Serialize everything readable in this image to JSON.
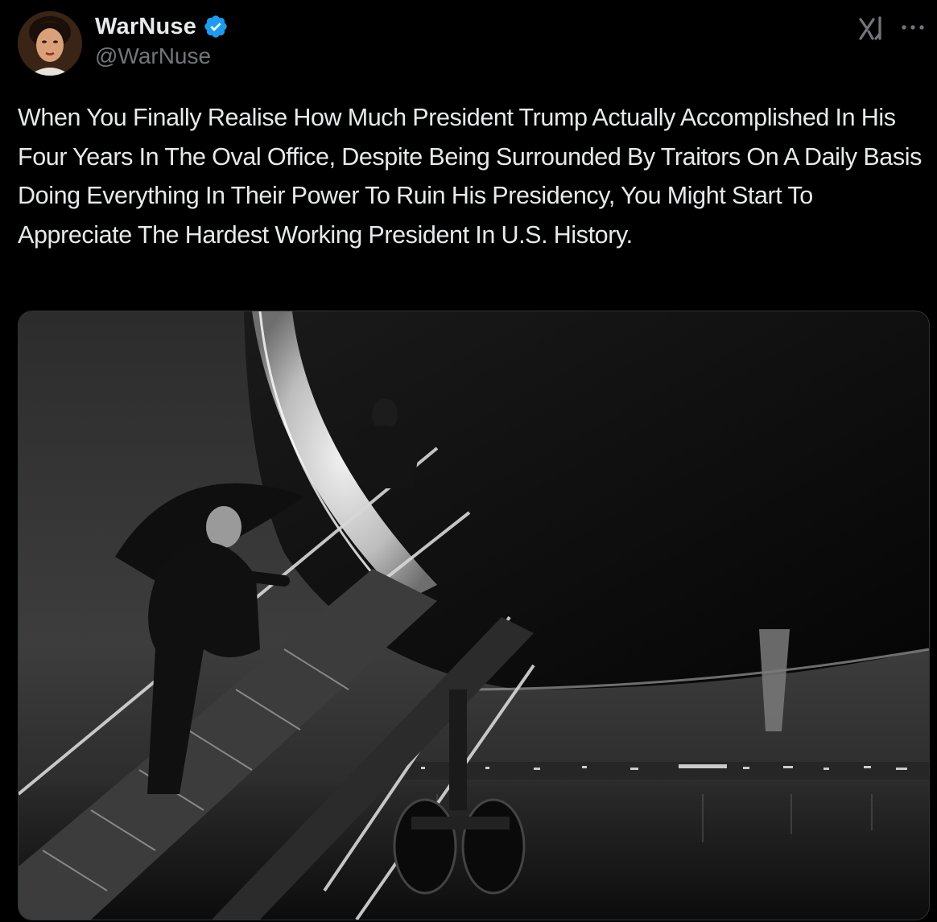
{
  "post": {
    "author": {
      "display_name": "WarNuse",
      "handle": "@WarNuse",
      "verified": true,
      "verified_color": "#1d9bf0"
    },
    "text": "When You Finally Realise How Much President Trump Actually Accomplished In His Four Years In The Oval Office, Despite Being Surrounded By Traitors On A Daily Basis Doing Everything In Their Power To Ruin His Presidency, You Might Start To Appreciate The Hardest Working President In U.S. History.",
    "media": {
      "type": "photo",
      "style": "black-and-white"
    }
  },
  "icons": {
    "verified": "verified-badge-icon",
    "grok": "grok-icon",
    "more": "more-options-icon"
  },
  "colors": {
    "background": "#000000",
    "text_primary": "#e7e9ea",
    "text_secondary": "#71767b",
    "border": "#2f3336",
    "accent": "#1d9bf0"
  }
}
